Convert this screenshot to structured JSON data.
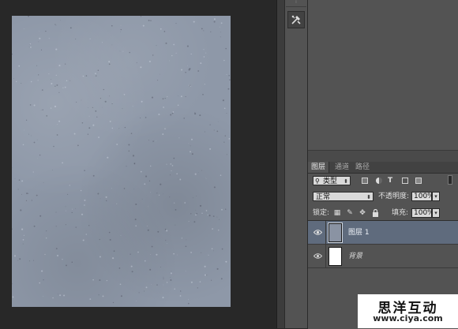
{
  "panels": {
    "tabs": [
      {
        "label": "图层",
        "active": true
      },
      {
        "label": "通道",
        "active": false
      },
      {
        "label": "路径",
        "active": false
      }
    ]
  },
  "filter": {
    "type_label": "类型",
    "search_icon": "search-icon",
    "icons": [
      "image-filter-icon",
      "adjustment-filter-icon",
      "text-filter-icon",
      "shape-filter-icon",
      "smart-object-filter-icon"
    ]
  },
  "blend": {
    "mode": "正常",
    "opacity_label": "不透明度:",
    "opacity_value": "100%"
  },
  "lock": {
    "label": "锁定:",
    "fill_label": "填充:",
    "fill_value": "100%"
  },
  "layers": [
    {
      "name": "图层 1",
      "selected": true,
      "visible": true
    },
    {
      "name": "背景",
      "selected": false,
      "visible": true
    }
  ],
  "watermark": {
    "title": "思洋互动",
    "url": "www.ciya.com"
  },
  "colors": {
    "canvas_bg": "#282828",
    "panel_bg": "#535353",
    "selected_layer": "#5f6b7d",
    "document": "#8e98a8"
  }
}
